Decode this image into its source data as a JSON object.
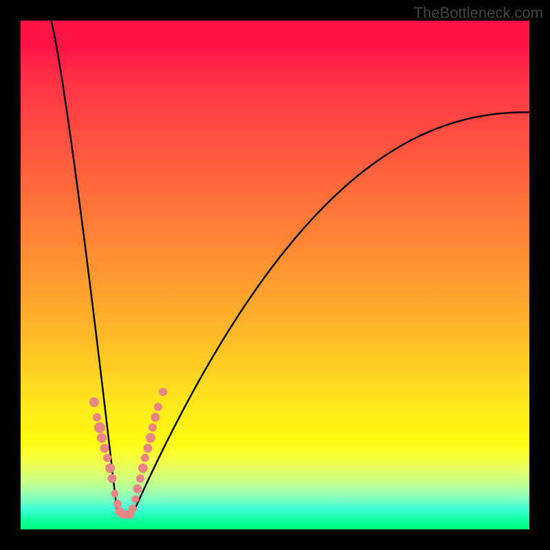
{
  "watermark": "TheBottleneck.com",
  "chart_data": {
    "type": "line",
    "title": "",
    "xlabel": "",
    "ylabel": "",
    "xlim": [
      0,
      100
    ],
    "ylim": [
      0,
      100
    ],
    "curve_left": {
      "type": "descending",
      "start_x": 6,
      "start_y": 0,
      "end_x": 19,
      "end_y": 97
    },
    "curve_right": {
      "type": "ascending",
      "start_x": 22,
      "start_y": 97,
      "end_x": 100,
      "end_y": 18
    },
    "bottom_flat": {
      "start_x": 19,
      "end_x": 22,
      "y": 97
    },
    "markers": [
      {
        "x": 14.5,
        "y": 75,
        "size": 14
      },
      {
        "x": 15.0,
        "y": 78,
        "size": 12
      },
      {
        "x": 15.5,
        "y": 80,
        "size": 16
      },
      {
        "x": 16.0,
        "y": 82,
        "size": 14
      },
      {
        "x": 16.5,
        "y": 84,
        "size": 13
      },
      {
        "x": 17.0,
        "y": 86,
        "size": 12
      },
      {
        "x": 17.5,
        "y": 88,
        "size": 14
      },
      {
        "x": 18.0,
        "y": 90,
        "size": 13
      },
      {
        "x": 18.5,
        "y": 93,
        "size": 11
      },
      {
        "x": 19.0,
        "y": 95,
        "size": 12
      },
      {
        "x": 19.5,
        "y": 96.5,
        "size": 13
      },
      {
        "x": 20.0,
        "y": 97,
        "size": 12
      },
      {
        "x": 20.5,
        "y": 97,
        "size": 11
      },
      {
        "x": 21.0,
        "y": 97,
        "size": 12
      },
      {
        "x": 21.5,
        "y": 97,
        "size": 13
      },
      {
        "x": 22.0,
        "y": 96,
        "size": 12
      },
      {
        "x": 22.5,
        "y": 94,
        "size": 11
      },
      {
        "x": 23.0,
        "y": 92,
        "size": 13
      },
      {
        "x": 23.5,
        "y": 90,
        "size": 12
      },
      {
        "x": 24.0,
        "y": 88,
        "size": 14
      },
      {
        "x": 24.5,
        "y": 86,
        "size": 12
      },
      {
        "x": 25.0,
        "y": 84,
        "size": 13
      },
      {
        "x": 25.5,
        "y": 82,
        "size": 14
      },
      {
        "x": 26.0,
        "y": 80,
        "size": 12
      },
      {
        "x": 26.5,
        "y": 78,
        "size": 13
      },
      {
        "x": 27.0,
        "y": 76,
        "size": 12
      },
      {
        "x": 28.0,
        "y": 73,
        "size": 12
      }
    ]
  }
}
